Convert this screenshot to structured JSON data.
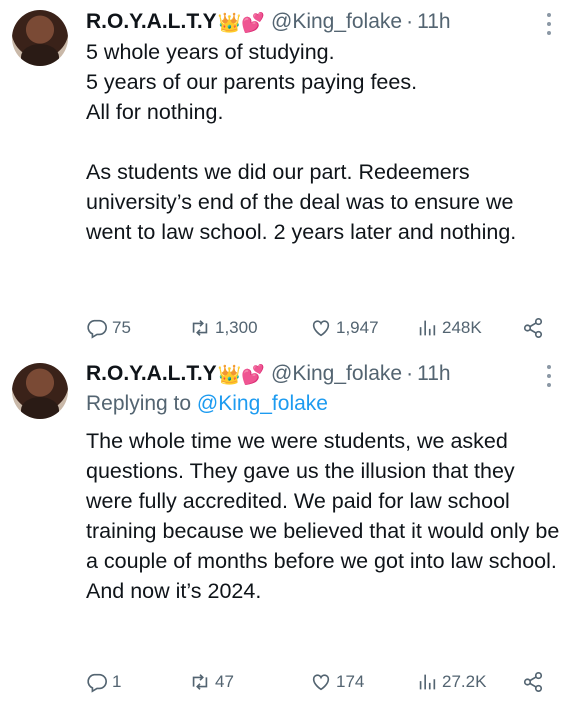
{
  "tweets": [
    {
      "author": {
        "name": "R.O.Y.A.L.T.Y",
        "emoji": "👑💕",
        "handle": "@King_folake",
        "separator": "·",
        "time": "11h"
      },
      "text": "5 whole years of studying.\n5 years of our parents paying fees.\nAll for nothing.\n\nAs students we did our part. Redeemers university’s end of the deal was to ensure we went to law school. 2 years later and nothing.",
      "stats": {
        "replies": "75",
        "retweets": "1,300",
        "likes": "1,947",
        "views": "248K"
      },
      "icons": [
        "reply-icon",
        "retweet-icon",
        "heart-icon",
        "views-icon",
        "share-icon"
      ]
    },
    {
      "author": {
        "name": "R.O.Y.A.L.T.Y",
        "emoji": "👑💕",
        "handle": "@King_folake",
        "separator": "·",
        "time": "11h"
      },
      "replying_prefix": "Replying to ",
      "replying_handle": "@King_folake",
      "text": "The whole time we were students, we asked questions. They gave us the illusion that they were fully accredited. We paid for law school training because we believed that it would only be a couple of months before we got into law school. And now it’s 2024.",
      "stats": {
        "replies": "1",
        "retweets": "47",
        "likes": "174",
        "views": "27.2K"
      },
      "icons": [
        "reply-icon",
        "retweet-icon",
        "heart-icon",
        "views-icon",
        "share-icon"
      ]
    }
  ],
  "colors": {
    "text": "#0f1419",
    "secondary": "#536471",
    "link": "#1d9bf0",
    "background": "#ffffff"
  }
}
